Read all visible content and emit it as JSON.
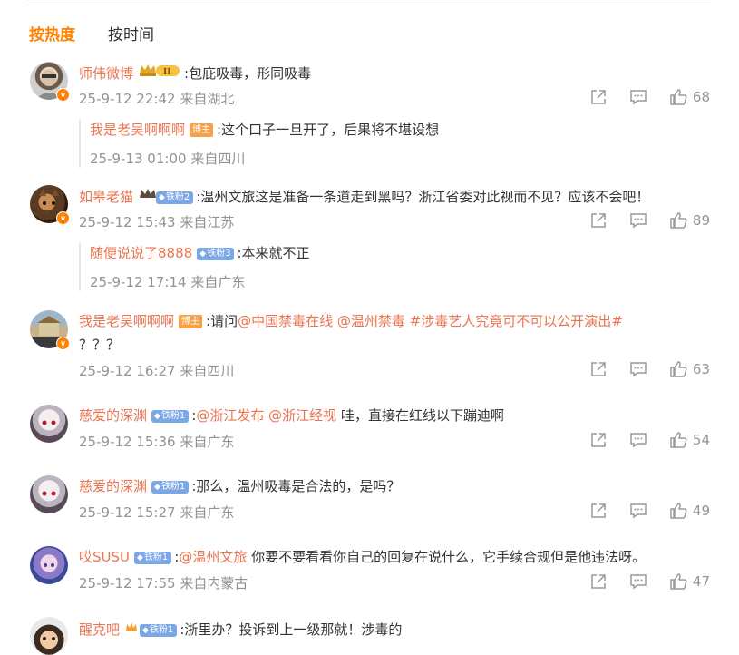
{
  "sort": {
    "hot": "按热度",
    "time": "按时间"
  },
  "comments": [
    {
      "user": "师伟微博",
      "badge": "crown-II",
      "text": ":包庇吸毒，形同吸毒",
      "time": "25-9-12 22:42",
      "loc": "来自湖北",
      "likes": "68",
      "reply": {
        "user": "我是老吴啊啊啊",
        "badge_label": "博主",
        "text": ":这个口子一旦开了，后果将不堪设想",
        "time": "25-9-13 01:00",
        "loc": "来自四川"
      }
    },
    {
      "user": "如皋老猫",
      "badge_label": "铁粉2",
      "text": ":温州文旅这是准备一条道走到黑吗？浙江省委对此视而不见？应该不会吧！",
      "time": "25-9-12 15:43",
      "loc": "来自江苏",
      "likes": "89",
      "reply": {
        "user": "随便说说了8888",
        "badge_label": "铁粉3",
        "text": ":本来就不正",
        "time": "25-9-12 17:14",
        "loc": "来自广东"
      }
    },
    {
      "user": "我是老吴啊啊啊",
      "badge_label": "博主",
      "text_prefix": ":请问",
      "links": [
        "@中国禁毒在线",
        "@温州禁毒",
        "#涉毒艺人究竟可不可以公开演出#"
      ],
      "text2": "？？？",
      "time": "25-9-12 16:27",
      "loc": "来自四川",
      "likes": "63"
    },
    {
      "user": "慈爱的深渊",
      "badge_label": "铁粉1",
      "text_prefix": ":",
      "links": [
        "@浙江发布",
        "@浙江经视"
      ],
      "text_suffix": " 哇，直接在红线以下蹦迪啊",
      "time": "25-9-12 15:36",
      "loc": "来自广东",
      "likes": "54"
    },
    {
      "user": "慈爱的深渊",
      "badge_label": "铁粉1",
      "text": ":那么，温州吸毒是合法的，是吗？",
      "time": "25-9-12 15:27",
      "loc": "来自广东",
      "likes": "49"
    },
    {
      "user": "哎SUSU",
      "badge_label": "铁粉1",
      "text_prefix": ":",
      "links": [
        "@温州文旅"
      ],
      "text_suffix": " 你要不要看看你自己的回复在说什么，它手续合规但是他违法呀。",
      "time": "25-9-12 17:55",
      "loc": "来自内蒙古",
      "likes": "47"
    },
    {
      "user": "醒克吧",
      "badge_label": "铁粉1",
      "text": ":浙里办？投诉到上一级那就！涉毒的"
    }
  ],
  "icons": {
    "share": "share-icon",
    "comment": "comment-icon",
    "like": "like-icon",
    "verified": "verified-icon"
  },
  "colors": {
    "accent": "#ff8200",
    "username": "#eb7350",
    "meta": "#939393"
  }
}
